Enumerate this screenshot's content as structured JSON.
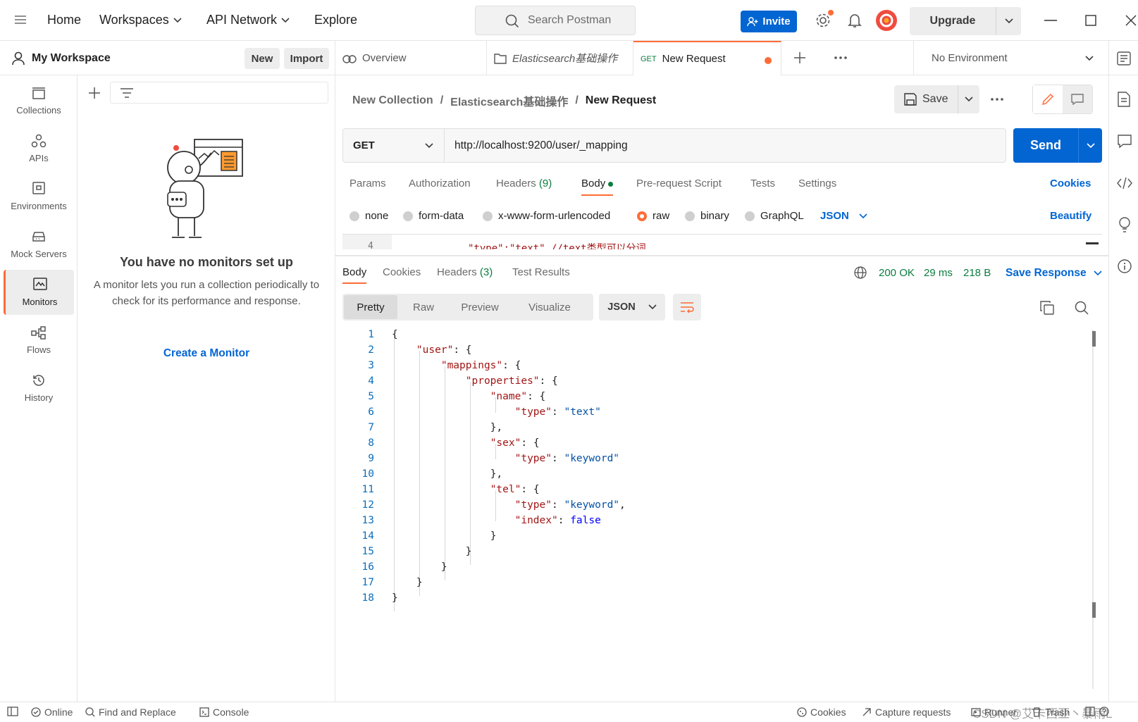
{
  "topbar": {
    "nav": [
      "Home",
      "Workspaces",
      "API Network",
      "Explore"
    ],
    "search_placeholder": "Search Postman",
    "invite_label": "Invite",
    "upgrade_label": "Upgrade"
  },
  "workspace": {
    "title": "My Workspace",
    "new_label": "New",
    "import_label": "Import"
  },
  "sidebar": {
    "items": [
      {
        "label": "Collections",
        "icon": "collections-icon"
      },
      {
        "label": "APIs",
        "icon": "apis-icon"
      },
      {
        "label": "Environments",
        "icon": "environments-icon"
      },
      {
        "label": "Mock Servers",
        "icon": "mock-servers-icon"
      },
      {
        "label": "Monitors",
        "icon": "monitors-icon",
        "active": true
      },
      {
        "label": "Flows",
        "icon": "flows-icon"
      },
      {
        "label": "History",
        "icon": "history-icon"
      }
    ]
  },
  "monitors": {
    "empty_title": "You have no monitors set up",
    "empty_desc": "A monitor lets you run a collection periodically to check for its performance and response.",
    "create_link": "Create a Monitor"
  },
  "tabs": {
    "overview": "Overview",
    "collection_tab": "Elasticsearch基础操作",
    "request_method": "GET",
    "request_tab": "New Request",
    "environment": "No Environment"
  },
  "breadcrumb": {
    "collection": "New Collection",
    "folder": "Elasticsearch基础操作",
    "request": "New Request",
    "separator": "/"
  },
  "request": {
    "save_label": "Save",
    "method": "GET",
    "url": "http://localhost:9200/user/_mapping",
    "send_label": "Send",
    "tabs": {
      "params": "Params",
      "authorization": "Authorization",
      "headers": "Headers",
      "headers_count": "(9)",
      "body": "Body",
      "prerequest": "Pre-request Script",
      "tests": "Tests",
      "settings": "Settings"
    },
    "cookies_label": "Cookies",
    "body_types": [
      "none",
      "form-data",
      "x-www-form-urlencoded",
      "raw",
      "binary",
      "GraphQL"
    ],
    "selected_body_type": "raw",
    "format": "JSON",
    "beautify_label": "Beautify",
    "editor_peek_line": "4",
    "editor_peek_text": "\"type\":\"text\" //text类型可以分词"
  },
  "response": {
    "tabs": {
      "body": "Body",
      "cookies": "Cookies",
      "headers": "Headers",
      "headers_count": "(3)",
      "test_results": "Test Results"
    },
    "status": "200 OK",
    "time": "29 ms",
    "size": "218 B",
    "save_response": "Save Response",
    "view_tabs": [
      "Pretty",
      "Raw",
      "Preview",
      "Visualize"
    ],
    "format": "JSON",
    "code_lines": [
      {
        "n": "1",
        "t": "{"
      },
      {
        "n": "2",
        "t": "    \"user\": {"
      },
      {
        "n": "3",
        "t": "        \"mappings\": {"
      },
      {
        "n": "4",
        "t": "            \"properties\": {"
      },
      {
        "n": "5",
        "t": "                \"name\": {"
      },
      {
        "n": "6",
        "t": "                    \"type\": \"text\""
      },
      {
        "n": "7",
        "t": "                },"
      },
      {
        "n": "8",
        "t": "                \"sex\": {"
      },
      {
        "n": "9",
        "t": "                    \"type\": \"keyword\""
      },
      {
        "n": "10",
        "t": "                },"
      },
      {
        "n": "11",
        "t": "                \"tel\": {"
      },
      {
        "n": "12",
        "t": "                    \"type\": \"keyword\","
      },
      {
        "n": "13",
        "t": "                    \"index\": false"
      },
      {
        "n": "14",
        "t": "                }"
      },
      {
        "n": "15",
        "t": "            }"
      },
      {
        "n": "16",
        "t": "        }"
      },
      {
        "n": "17",
        "t": "    }"
      },
      {
        "n": "18",
        "t": "}"
      }
    ]
  },
  "statusbar": {
    "online": "Online",
    "find_replace": "Find and Replace",
    "console": "Console",
    "cookies": "Cookies",
    "capture": "Capture requests",
    "runner": "Runner",
    "trash": "Trash",
    "watermark": "CSDN @艾卡西亚丶暴雨L"
  },
  "colors": {
    "accent": "#ff6c37",
    "primary": "#0265d2",
    "success": "#0a7d3f"
  }
}
